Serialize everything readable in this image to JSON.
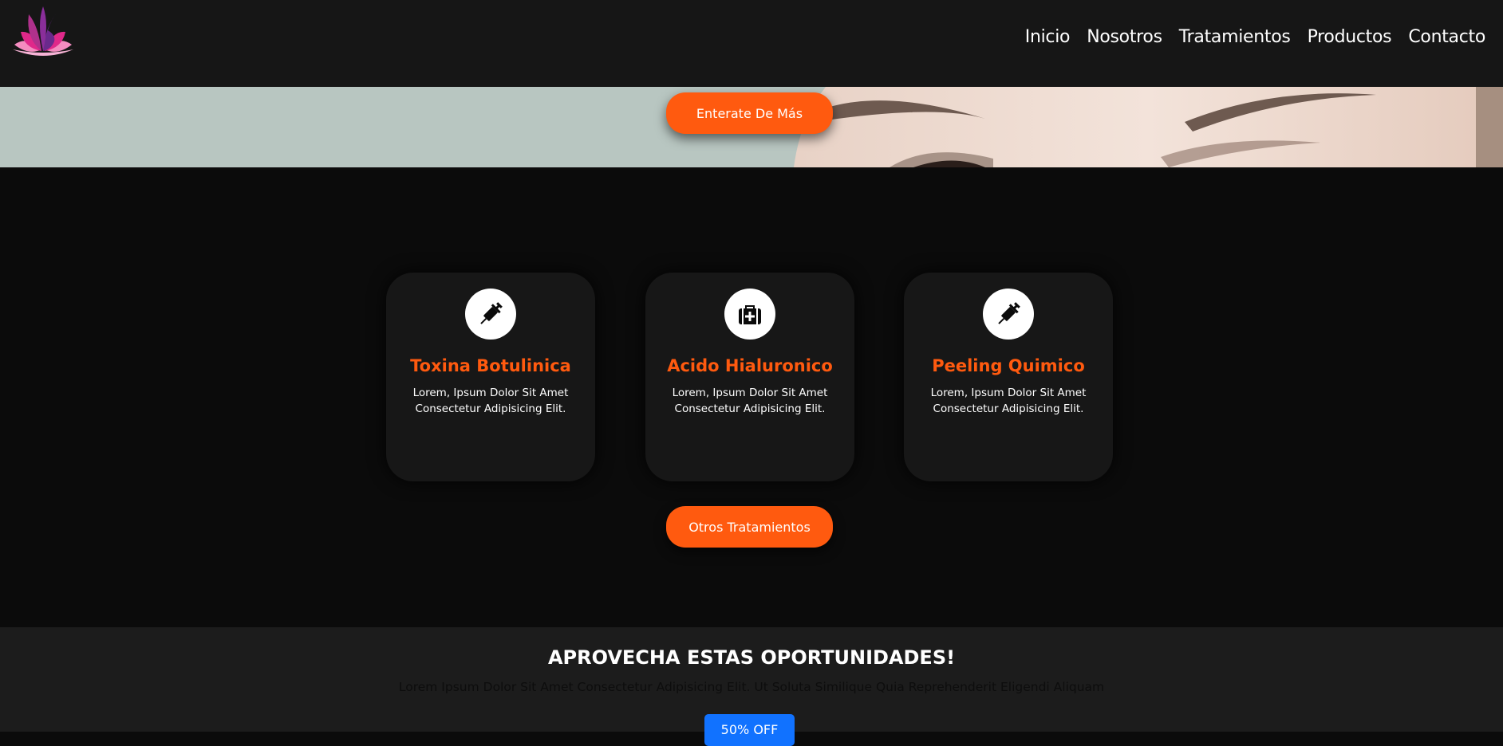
{
  "nav": {
    "links": [
      "Inicio",
      "Nosotros",
      "Tratamientos",
      "Productos",
      "Contacto"
    ]
  },
  "hero": {
    "button_label": "Enterate De Más"
  },
  "treatments": {
    "cards": [
      {
        "title": "Toxina Botulinica",
        "text": "Lorem, Ipsum Dolor Sit Amet Consectetur Adipisicing Elit.",
        "icon": "syringe-icon"
      },
      {
        "title": "Acido Hialuronico",
        "text": "Lorem, Ipsum Dolor Sit Amet Consectetur Adipisicing Elit.",
        "icon": "medical-kit-icon"
      },
      {
        "title": "Peeling Quimico",
        "text": "Lorem, Ipsum Dolor Sit Amet Consectetur Adipisicing Elit.",
        "icon": "syringe-icon"
      }
    ],
    "button_label": "Otros Tratamientos"
  },
  "promo": {
    "title": "APROVECHA ESTAS OPORTUNIDADES!",
    "text": "Lorem Ipsum Dolor Sit Amet Consectetur Adipisicing Elit. Ut Soluta Similique Quia Reprehenderit Eligendi Aliquam",
    "button_label": "50% OFF"
  },
  "colors": {
    "accent": "#ff5a0f",
    "promo_button": "#1172ff",
    "navbar": "#161616",
    "background": "#0b0b0b"
  }
}
